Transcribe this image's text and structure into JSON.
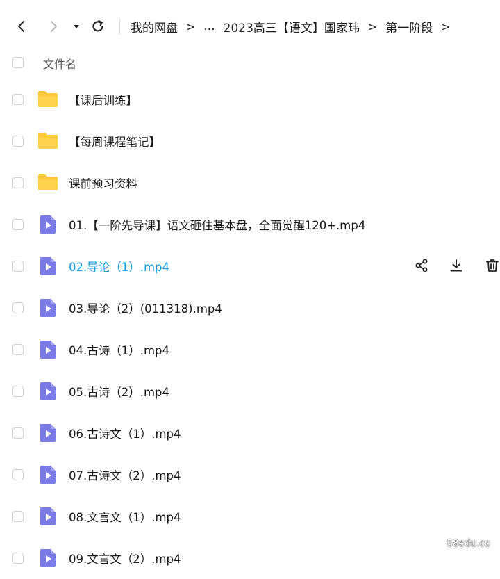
{
  "toolbar": {
    "breadcrumb": [
      "我的网盘",
      "...",
      "2023高三【语文】国家玮",
      "第一阶段"
    ],
    "breadcrumb_separator": ">"
  },
  "list": {
    "header_label": "文件名",
    "items": [
      {
        "type": "folder",
        "name": "【课后训练】"
      },
      {
        "type": "folder",
        "name": "【每周课程笔记】"
      },
      {
        "type": "folder",
        "name": "课前预习资料"
      },
      {
        "type": "video",
        "name": "01.【一阶先导课】语文砸住基本盘，全面觉醒120+.mp4"
      },
      {
        "type": "video",
        "name": "02.导论（1）.mp4",
        "active": true
      },
      {
        "type": "video",
        "name": "03.导论（2）(011318).mp4"
      },
      {
        "type": "video",
        "name": "04.古诗（1）.mp4"
      },
      {
        "type": "video",
        "name": "05.古诗（2）.mp4"
      },
      {
        "type": "video",
        "name": "06.古诗文（1）.mp4"
      },
      {
        "type": "video",
        "name": "07.古诗文（2）.mp4"
      },
      {
        "type": "video",
        "name": "08.文言文（1）.mp4"
      },
      {
        "type": "video",
        "name": "09.文言文（2）.mp4"
      }
    ]
  },
  "row_actions": {
    "icons": [
      "share-icon",
      "download-icon",
      "delete-icon"
    ]
  },
  "colors": {
    "folder": "#FFC93C",
    "video": "#7B7BE8",
    "active_text": "#1AA0E0"
  },
  "watermark": "58edu.cc"
}
